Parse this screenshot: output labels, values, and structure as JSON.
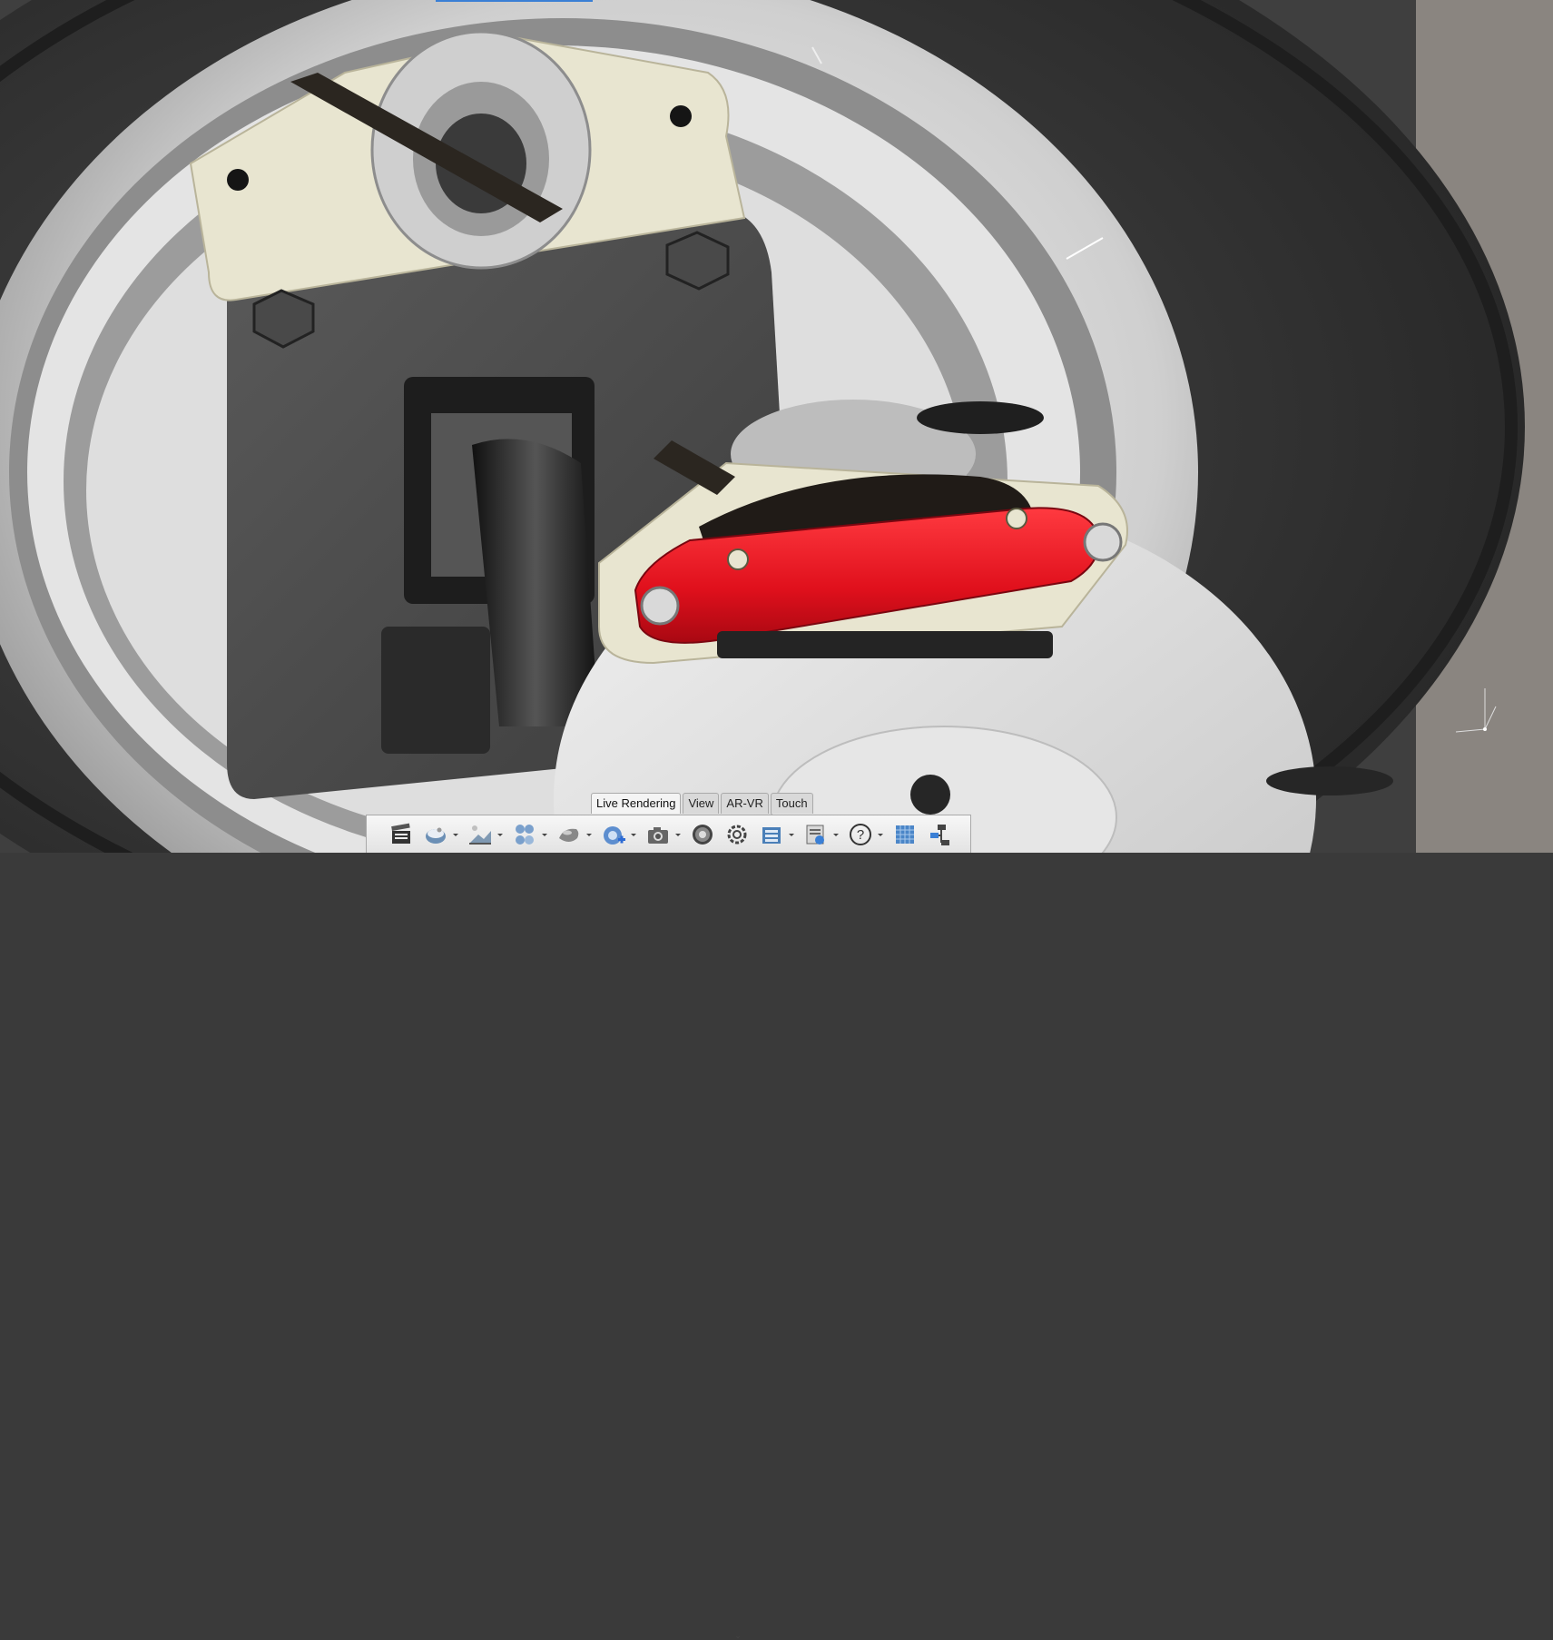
{
  "app": {
    "viewport_content": "3D model: wheel hub with brake caliper and rotor (Live Rendering)"
  },
  "tabs": [
    {
      "label": "Live Rendering",
      "active": true
    },
    {
      "label": "View",
      "active": false
    },
    {
      "label": "AR-VR",
      "active": false
    },
    {
      "label": "Touch",
      "active": false
    }
  ],
  "toolbar": {
    "collapse_glyph": "⌄",
    "tools": [
      {
        "icon": "clapperboard-icon",
        "dropdown": false
      },
      {
        "icon": "scene-icon",
        "dropdown": true
      },
      {
        "icon": "environment-icon",
        "dropdown": true
      },
      {
        "icon": "appearances-icon",
        "dropdown": true
      },
      {
        "icon": "material-sphere-icon",
        "dropdown": true
      },
      {
        "icon": "add-decal-icon",
        "dropdown": true
      },
      {
        "icon": "camera-icon",
        "dropdown": true
      },
      {
        "icon": "aperture-icon",
        "dropdown": false
      },
      {
        "icon": "settings-gear-icon",
        "dropdown": false
      },
      {
        "icon": "render-library-icon",
        "dropdown": true
      },
      {
        "icon": "render-settings-icon",
        "dropdown": true
      },
      {
        "icon": "help-icon",
        "dropdown": true
      },
      {
        "icon": "display-grid-icon",
        "dropdown": false
      },
      {
        "icon": "tree-structure-icon",
        "dropdown": false
      }
    ]
  },
  "colors": {
    "caliper_red": "#e0101c",
    "tire_dark": "#333333",
    "rim_silver": "#d8d8d8",
    "bracket_ivory": "#e8e5d0"
  }
}
